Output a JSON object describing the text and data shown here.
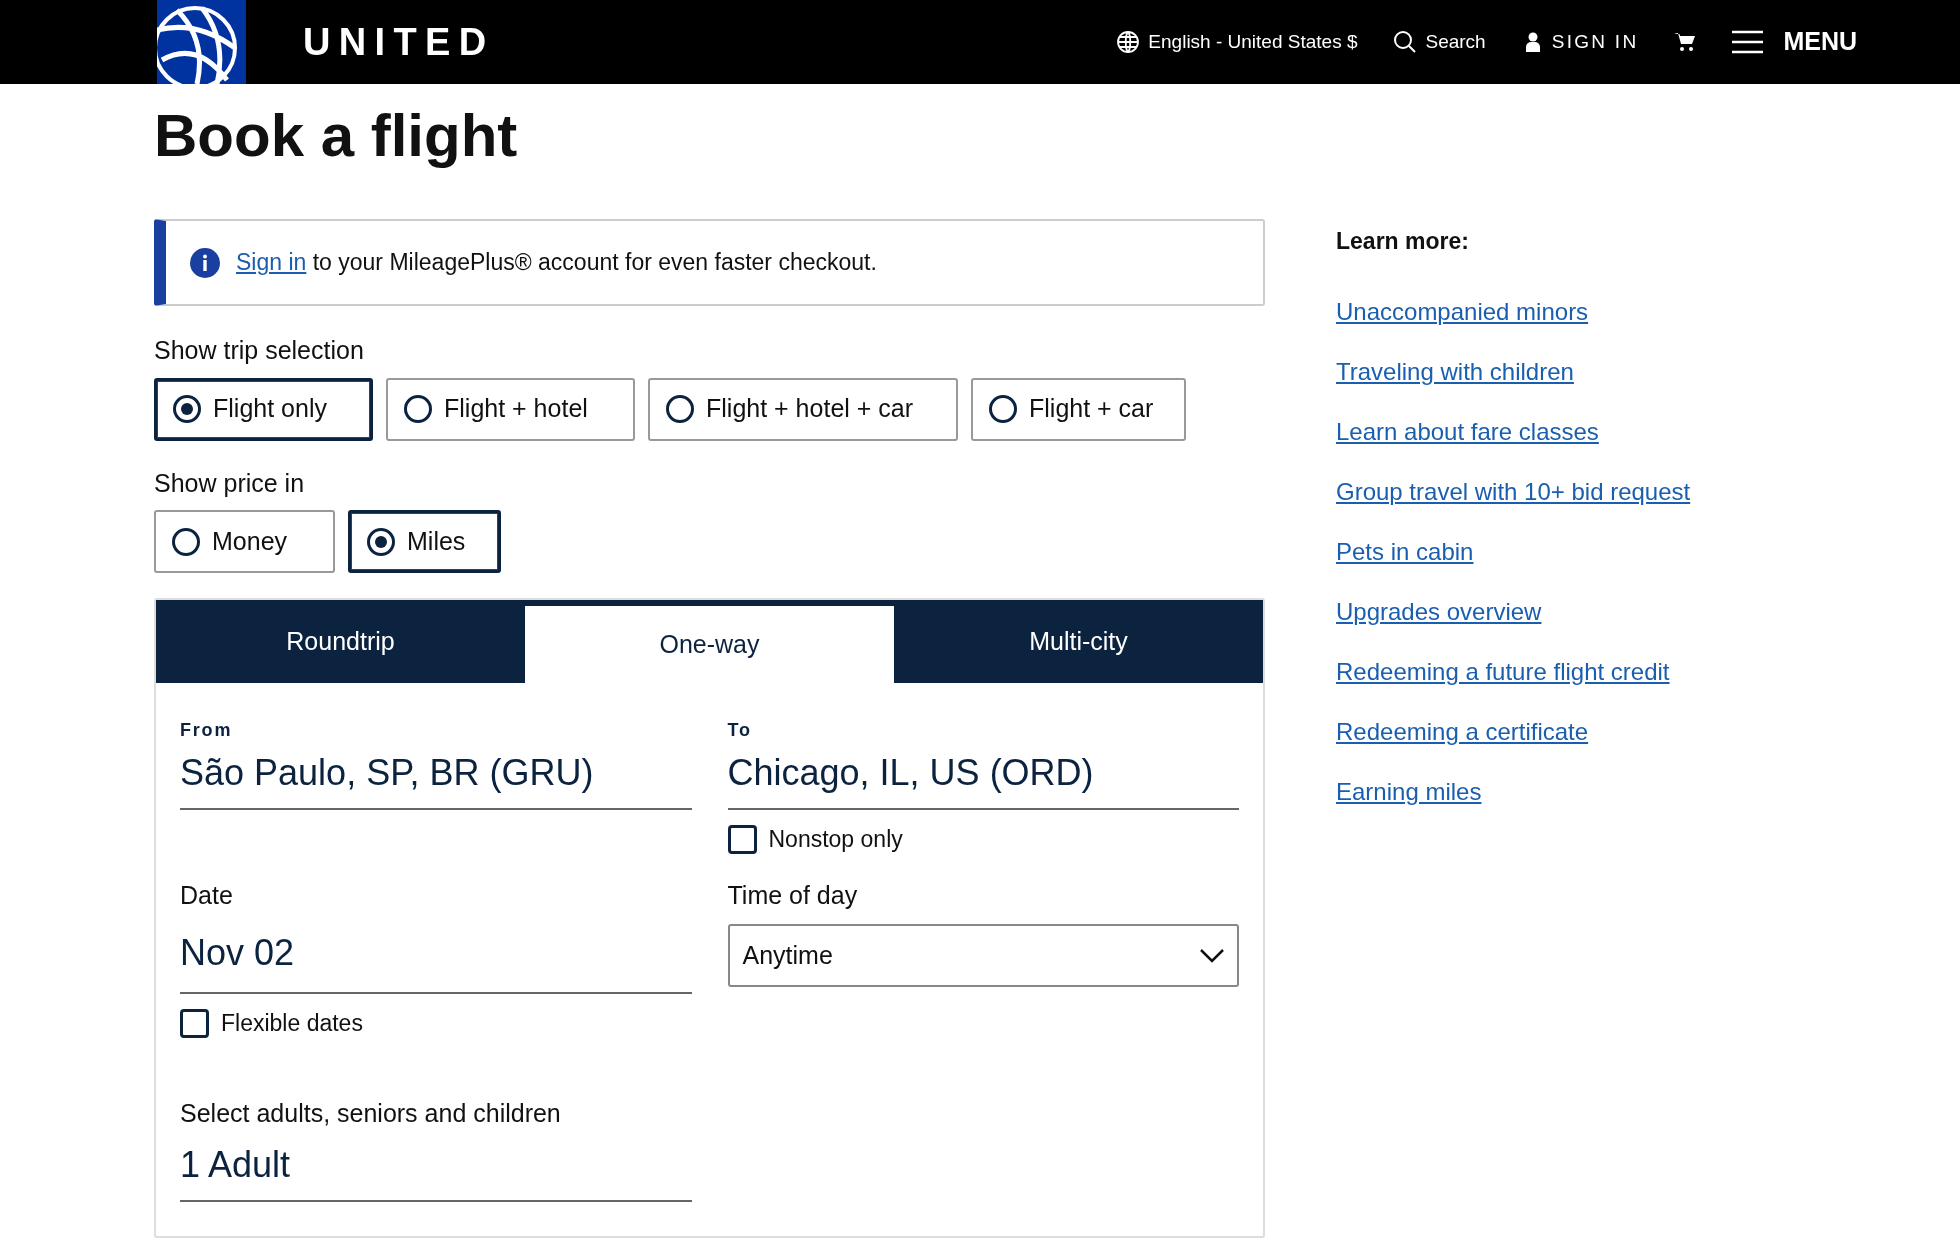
{
  "header": {
    "brand": "UNITED",
    "language": "English - United States $",
    "search": "Search",
    "sign_in": "SIGN IN",
    "menu": "MENU"
  },
  "title": "Book a flight",
  "notice": {
    "link": "Sign in",
    "text": "to your MileagePlus® account for even faster checkout."
  },
  "trip_selection": {
    "label": "Show trip selection",
    "options": [
      {
        "label": "Flight only",
        "selected": true
      },
      {
        "label": "Flight + hotel",
        "selected": false
      },
      {
        "label": "Flight + hotel + car",
        "selected": false
      },
      {
        "label": "Flight + car",
        "selected": false
      }
    ]
  },
  "price_in": {
    "label": "Show price in",
    "options": [
      {
        "label": "Money",
        "selected": false
      },
      {
        "label": "Miles",
        "selected": true
      }
    ]
  },
  "tabs": [
    {
      "label": "Roundtrip",
      "selected": false
    },
    {
      "label": "One-way",
      "selected": true
    },
    {
      "label": "Multi-city",
      "selected": false
    }
  ],
  "form": {
    "from": {
      "label": "From",
      "value": "São Paulo, SP, BR (GRU)"
    },
    "to": {
      "label": "To",
      "value": "Chicago, IL, US (ORD)"
    },
    "nonstop": {
      "label": "Nonstop only",
      "checked": false
    },
    "date": {
      "label": "Date",
      "value": "Nov 02"
    },
    "flexible": {
      "label": "Flexible dates",
      "checked": false
    },
    "time_of_day": {
      "label": "Time of day",
      "value": "Anytime"
    },
    "travelers": {
      "label": "Select adults, seniors and children",
      "value": "1 Adult"
    }
  },
  "learn_more": {
    "title": "Learn more:",
    "links": [
      "Unaccompanied minors",
      "Traveling with children",
      "Learn about fare classes",
      "Group travel with 10+ bid request",
      "Pets in cabin",
      "Upgrades overview",
      "Redeeming a future flight credit",
      "Redeeming a certificate",
      "Earning miles"
    ]
  }
}
